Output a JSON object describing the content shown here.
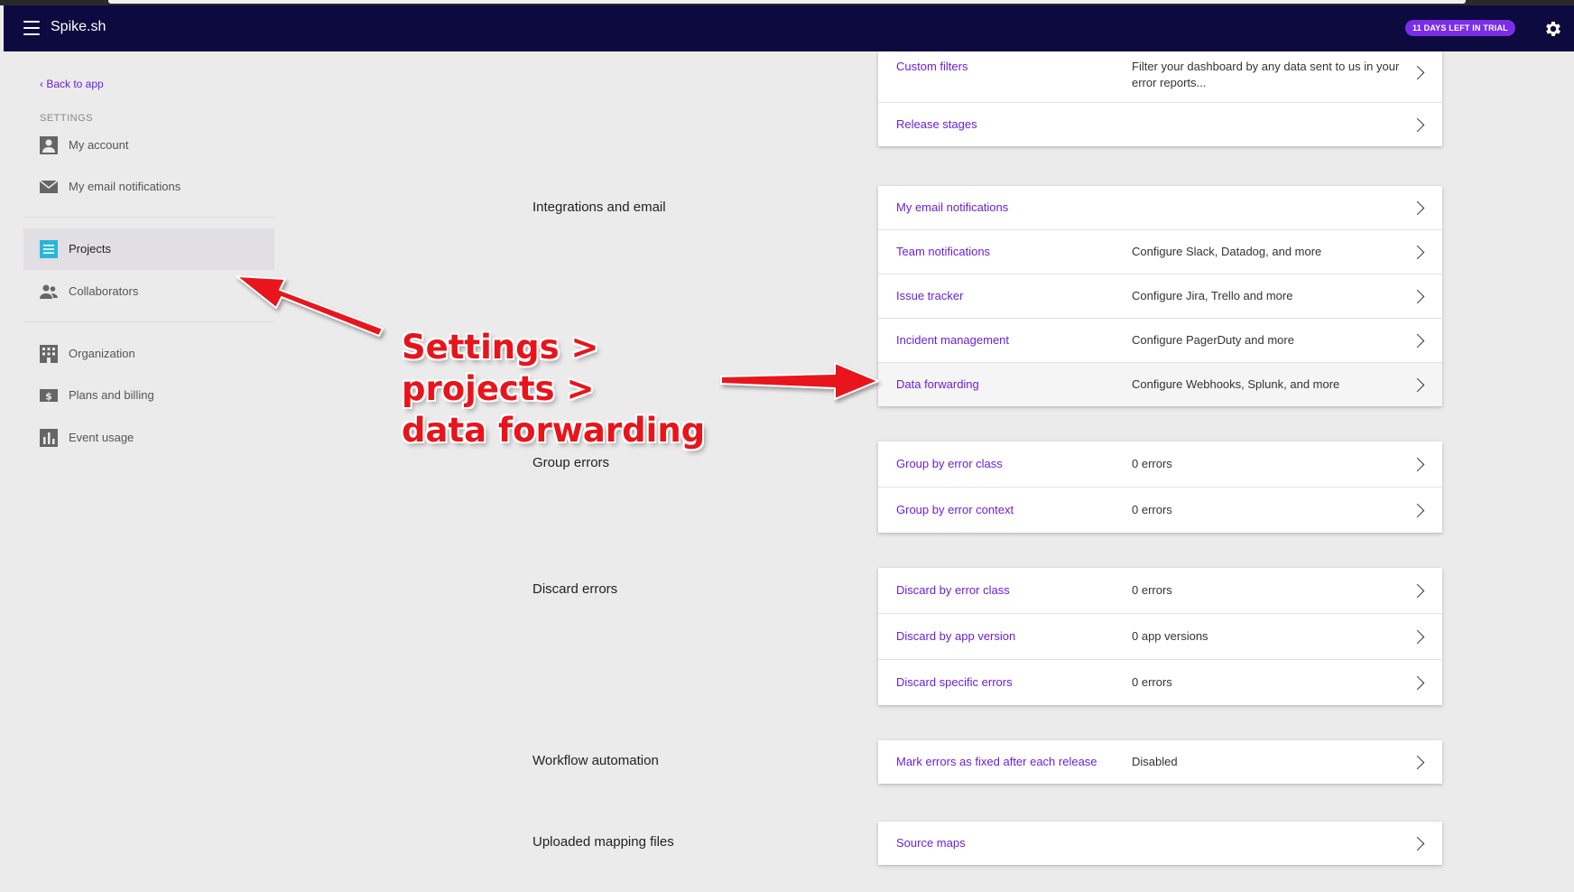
{
  "header": {
    "brand": "Spike.sh",
    "trial_badge": "11 DAYS LEFT IN TRIAL",
    "colors": {
      "background": "#0c0a3e",
      "badge": "#7a2ee6"
    }
  },
  "sidebar": {
    "back_link": "‹ Back to app",
    "heading": "SETTINGS",
    "items": [
      {
        "label": "My account",
        "icon": "person-icon"
      },
      {
        "label": "My email notifications",
        "icon": "envelope-icon"
      },
      {
        "label": "Projects",
        "icon": "projects-icon",
        "active": true
      },
      {
        "label": "Collaborators",
        "icon": "people-icon"
      },
      {
        "label": "Organization",
        "icon": "building-icon"
      },
      {
        "label": "Plans and billing",
        "icon": "dollar-icon"
      },
      {
        "label": "Event usage",
        "icon": "bar-chart-icon"
      }
    ]
  },
  "sections": {
    "top": {
      "rows": [
        {
          "title": "Custom filters",
          "desc": "Filter your dashboard by any data sent to us in your error reports..."
        },
        {
          "title": "Release stages",
          "desc": ""
        }
      ]
    },
    "integrations": {
      "label": "Integrations and email",
      "rows": [
        {
          "title": "My email notifications",
          "desc": ""
        },
        {
          "title": "Team notifications",
          "desc": "Configure Slack, Datadog, and more"
        },
        {
          "title": "Issue tracker",
          "desc": "Configure Jira, Trello and more"
        },
        {
          "title": "Incident management",
          "desc": "Configure PagerDuty and more"
        },
        {
          "title": "Data forwarding",
          "desc": "Configure Webhooks, Splunk, and more"
        }
      ]
    },
    "group": {
      "label": "Group errors",
      "rows": [
        {
          "title": "Group by error class",
          "desc": "0 errors"
        },
        {
          "title": "Group by error context",
          "desc": "0 errors"
        }
      ]
    },
    "discard": {
      "label": "Discard errors",
      "rows": [
        {
          "title": "Discard by error class",
          "desc": "0 errors"
        },
        {
          "title": "Discard by app version",
          "desc": "0 app versions"
        },
        {
          "title": "Discard specific errors",
          "desc": "0 errors"
        }
      ]
    },
    "workflow": {
      "label": "Workflow automation",
      "rows": [
        {
          "title": "Mark errors as fixed after each release",
          "desc": "Disabled"
        }
      ]
    },
    "mapping": {
      "label": "Uploaded mapping files",
      "rows": [
        {
          "title": "Source maps",
          "desc": ""
        }
      ]
    }
  },
  "annotation": {
    "line1": "Settings > projects >",
    "line2": "data forwarding",
    "color": "#e8141b"
  }
}
